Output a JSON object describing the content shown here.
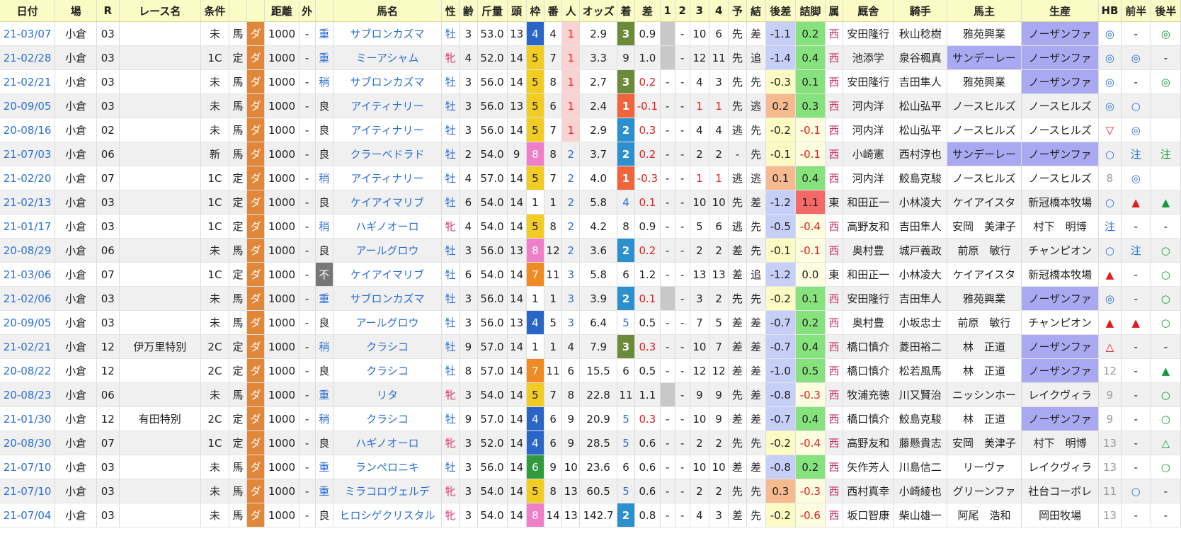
{
  "columns": [
    "日付",
    "場",
    "R",
    "レース名",
    "条件",
    "",
    "",
    "距離",
    "外",
    "",
    "馬名",
    "性",
    "齢",
    "斤量",
    "頭",
    "枠",
    "番",
    "人",
    "オッズ",
    "着",
    "差",
    "1",
    "2",
    "3",
    "4",
    "予",
    "結",
    "後差",
    "詰脚",
    "属",
    "厩舎",
    "騎手",
    "馬主",
    "生産",
    "HB",
    "前半",
    "後半"
  ],
  "colors": {
    "header_bg": "#fbfbc6",
    "link_blue": "#2a6fd6",
    "dirt_orange": "#e0873a",
    "stripe": "#f0f0f0",
    "waku": {
      "1": "#ffffff",
      "4": "#2a65c8",
      "5": "#f1cc22",
      "6": "#2f9b3c",
      "7": "#f08a22",
      "8": "#ef80c8"
    },
    "finish": {
      "1": "#f0643c",
      "2": "#2c8fce",
      "3": "#6b8a3a"
    }
  },
  "rows": [
    {
      "date": "21-03/07",
      "place": "小倉",
      "r": "03",
      "race": "",
      "cls": "未",
      "kind": "馬",
      "surf": "ダ",
      "dist": "1000",
      "out": "-",
      "cond": "重",
      "horse": "サブロンカズマ",
      "sex": "牡",
      "age": "3",
      "kin": "53.0",
      "heads": "13",
      "waku": "4",
      "ban": "4",
      "pop": "1",
      "odds": "2.9",
      "fin": "3",
      "diff": "0.9",
      "p1": "",
      "p2": "-",
      "p3": "10",
      "p4": "6",
      "yo": "先",
      "ke": "差",
      "kosa": "-1.1",
      "tsume": "0.2",
      "zoku": "西",
      "stable": "安田隆行",
      "jockey": "秋山稔樹",
      "owner": "雅苑興業",
      "breeder": "ノーザンファ",
      "hb": "◎",
      "zen": "-",
      "kou": "◎"
    },
    {
      "date": "21-02/28",
      "place": "小倉",
      "r": "03",
      "race": "",
      "cls": "1C",
      "kind": "定",
      "surf": "ダ",
      "dist": "1000",
      "out": "-",
      "cond": "重",
      "horse": "ミーアシャム",
      "sex": "牝",
      "age": "4",
      "kin": "52.0",
      "heads": "14",
      "waku": "5",
      "ban": "7",
      "pop": "1",
      "odds": "3.3",
      "fin": "9",
      "diff": "1.0",
      "p1": "",
      "p2": "-",
      "p3": "12",
      "p4": "11",
      "yo": "先",
      "ke": "追",
      "kosa": "-1.4",
      "tsume": "0.4",
      "zoku": "西",
      "stable": "池添学",
      "jockey": "泉谷楓真",
      "owner": "サンデーレー",
      "breeder": "ノーザンファ",
      "hb": "◎",
      "zen": "◎",
      "kou": "-"
    },
    {
      "date": "21-02/21",
      "place": "小倉",
      "r": "03",
      "race": "",
      "cls": "未",
      "kind": "馬",
      "surf": "ダ",
      "dist": "1000",
      "out": "-",
      "cond": "稍",
      "horse": "サブロンカズマ",
      "sex": "牡",
      "age": "3",
      "kin": "56.0",
      "heads": "14",
      "waku": "5",
      "ban": "8",
      "pop": "1",
      "odds": "2.7",
      "fin": "3",
      "diff": "0.2",
      "p1": "-",
      "p2": "-",
      "p3": "4",
      "p4": "3",
      "yo": "先",
      "ke": "先",
      "kosa": "-0.3",
      "tsume": "0.1",
      "zoku": "西",
      "stable": "安田隆行",
      "jockey": "吉田隼人",
      "owner": "雅苑興業",
      "breeder": "ノーザンファ",
      "hb": "◎",
      "zen": "-",
      "kou": "◎"
    },
    {
      "date": "20-09/05",
      "place": "小倉",
      "r": "03",
      "race": "",
      "cls": "未",
      "kind": "馬",
      "surf": "ダ",
      "dist": "1000",
      "out": "-",
      "cond": "良",
      "horse": "アイティナリー",
      "sex": "牡",
      "age": "3",
      "kin": "56.0",
      "heads": "13",
      "waku": "5",
      "ban": "6",
      "pop": "1",
      "odds": "2.4",
      "fin": "1",
      "diff": "-0.1",
      "p1": "-",
      "p2": "-",
      "p3": "1",
      "p4": "1",
      "yo": "先",
      "ke": "逃",
      "kosa": "0.2",
      "tsume": "0.3",
      "zoku": "西",
      "stable": "河内洋",
      "jockey": "松山弘平",
      "owner": "ノースヒルズ",
      "breeder": "ノースヒルズ",
      "hb": "◎",
      "zen": "○",
      "kou": ""
    },
    {
      "date": "20-08/16",
      "place": "小倉",
      "r": "02",
      "race": "",
      "cls": "未",
      "kind": "馬",
      "surf": "ダ",
      "dist": "1000",
      "out": "-",
      "cond": "良",
      "horse": "アイティナリー",
      "sex": "牡",
      "age": "3",
      "kin": "56.0",
      "heads": "14",
      "waku": "5",
      "ban": "7",
      "pop": "1",
      "odds": "2.9",
      "fin": "2",
      "diff": "0.3",
      "p1": "-",
      "p2": "-",
      "p3": "4",
      "p4": "4",
      "yo": "逃",
      "ke": "先",
      "kosa": "-0.2",
      "tsume": "-0.1",
      "zoku": "西",
      "stable": "河内洋",
      "jockey": "松山弘平",
      "owner": "ノースヒルズ",
      "breeder": "ノースヒルズ",
      "hb": "▽",
      "zen": "◎",
      "kou": ""
    },
    {
      "date": "21-07/03",
      "place": "小倉",
      "r": "06",
      "race": "",
      "cls": "新",
      "kind": "馬",
      "surf": "ダ",
      "dist": "1000",
      "out": "-",
      "cond": "良",
      "horse": "クラーベドラド",
      "sex": "牡",
      "age": "2",
      "kin": "54.0",
      "heads": "9",
      "waku": "8",
      "ban": "8",
      "pop": "2",
      "odds": "3.7",
      "fin": "2",
      "diff": "0.2",
      "p1": "-",
      "p2": "-",
      "p3": "2",
      "p4": "2",
      "yo": "-",
      "ke": "先",
      "kosa": "-0.1",
      "tsume": "-0.1",
      "zoku": "西",
      "stable": "小崎憲",
      "jockey": "西村淳也",
      "owner": "サンデーレー",
      "breeder": "ノーザンファ",
      "hb": "○",
      "zen": "注",
      "kou": "注"
    },
    {
      "date": "21-02/20",
      "place": "小倉",
      "r": "07",
      "race": "",
      "cls": "1C",
      "kind": "定",
      "surf": "ダ",
      "dist": "1000",
      "out": "-",
      "cond": "稍",
      "horse": "アイティナリー",
      "sex": "牡",
      "age": "4",
      "kin": "57.0",
      "heads": "14",
      "waku": "5",
      "ban": "7",
      "pop": "2",
      "odds": "4.0",
      "fin": "1",
      "diff": "-0.3",
      "p1": "-",
      "p2": "-",
      "p3": "1",
      "p4": "1",
      "yo": "逃",
      "ke": "逃",
      "kosa": "0.1",
      "tsume": "0.4",
      "zoku": "西",
      "stable": "河内洋",
      "jockey": "鮫島克駿",
      "owner": "ノースヒルズ",
      "breeder": "ノースヒルズ",
      "hb": "8",
      "zen": "◎",
      "kou": ""
    },
    {
      "date": "21-02/13",
      "place": "小倉",
      "r": "03",
      "race": "",
      "cls": "1C",
      "kind": "定",
      "surf": "ダ",
      "dist": "1000",
      "out": "-",
      "cond": "良",
      "horse": "ケイアイマリブ",
      "sex": "牡",
      "age": "6",
      "kin": "54.0",
      "heads": "14",
      "waku": "1",
      "ban": "1",
      "pop": "2",
      "odds": "5.8",
      "fin": "4",
      "diff": "0.1",
      "p1": "-",
      "p2": "-",
      "p3": "10",
      "p4": "10",
      "yo": "先",
      "ke": "差",
      "kosa": "-1.2",
      "tsume": "1.1",
      "zoku": "東",
      "stable": "和田正一",
      "jockey": "小林凌大",
      "owner": "ケイアイスタ",
      "breeder": "新冠橋本牧場",
      "hb": "○",
      "zen": "▲",
      "kou": "▲"
    },
    {
      "date": "21-01/17",
      "place": "小倉",
      "r": "03",
      "race": "",
      "cls": "1C",
      "kind": "定",
      "surf": "ダ",
      "dist": "1000",
      "out": "-",
      "cond": "稍",
      "horse": "ハギノオーロ",
      "sex": "牝",
      "age": "4",
      "kin": "54.0",
      "heads": "14",
      "waku": "5",
      "ban": "8",
      "pop": "2",
      "odds": "4.2",
      "fin": "8",
      "diff": "0.9",
      "p1": "-",
      "p2": "-",
      "p3": "5",
      "p4": "6",
      "yo": "逃",
      "ke": "先",
      "kosa": "-0.5",
      "tsume": "-0.4",
      "zoku": "西",
      "stable": "高野友和",
      "jockey": "吉田隼人",
      "owner": "安岡　美津子",
      "breeder": "村下　明博",
      "hb": "注",
      "zen": "-",
      "kou": "-"
    },
    {
      "date": "20-08/29",
      "place": "小倉",
      "r": "06",
      "race": "",
      "cls": "未",
      "kind": "馬",
      "surf": "ダ",
      "dist": "1000",
      "out": "-",
      "cond": "良",
      "horse": "アールグロウ",
      "sex": "牡",
      "age": "3",
      "kin": "56.0",
      "heads": "13",
      "waku": "8",
      "ban": "12",
      "pop": "2",
      "odds": "3.6",
      "fin": "2",
      "diff": "0.2",
      "p1": "-",
      "p2": "-",
      "p3": "2",
      "p4": "2",
      "yo": "差",
      "ke": "先",
      "kosa": "-0.1",
      "tsume": "-0.1",
      "zoku": "西",
      "stable": "奥村豊",
      "jockey": "城戸義政",
      "owner": "前原　敏行",
      "breeder": "チャンピオン",
      "hb": "○",
      "zen": "注",
      "kou": "○"
    },
    {
      "date": "21-03/06",
      "place": "小倉",
      "r": "07",
      "race": "",
      "cls": "1C",
      "kind": "定",
      "surf": "ダ",
      "dist": "1000",
      "out": "-",
      "cond": "不",
      "horse": "ケイアイマリブ",
      "sex": "牡",
      "age": "6",
      "kin": "54.0",
      "heads": "14",
      "waku": "7",
      "ban": "11",
      "pop": "3",
      "odds": "5.8",
      "fin": "6",
      "diff": "1.2",
      "p1": "-",
      "p2": "-",
      "p3": "13",
      "p4": "13",
      "yo": "差",
      "ke": "追",
      "kosa": "-1.2",
      "tsume": "0.0",
      "zoku": "東",
      "stable": "和田正一",
      "jockey": "小林凌大",
      "owner": "ケイアイスタ",
      "breeder": "新冠橋本牧場",
      "hb": "▲",
      "zen": "-",
      "kou": "○"
    },
    {
      "date": "21-02/06",
      "place": "小倉",
      "r": "03",
      "race": "",
      "cls": "未",
      "kind": "馬",
      "surf": "ダ",
      "dist": "1000",
      "out": "-",
      "cond": "重",
      "horse": "サブロンカズマ",
      "sex": "牡",
      "age": "3",
      "kin": "56.0",
      "heads": "14",
      "waku": "1",
      "ban": "1",
      "pop": "3",
      "odds": "3.9",
      "fin": "2",
      "diff": "0.1",
      "p1": "",
      "p2": "-",
      "p3": "3",
      "p4": "2",
      "yo": "先",
      "ke": "先",
      "kosa": "-0.2",
      "tsume": "0.1",
      "zoku": "西",
      "stable": "安田隆行",
      "jockey": "吉田隼人",
      "owner": "雅苑興業",
      "breeder": "ノーザンファ",
      "hb": "◎",
      "zen": "-",
      "kou": "○"
    },
    {
      "date": "20-09/05",
      "place": "小倉",
      "r": "03",
      "race": "",
      "cls": "未",
      "kind": "馬",
      "surf": "ダ",
      "dist": "1000",
      "out": "-",
      "cond": "良",
      "horse": "アールグロウ",
      "sex": "牡",
      "age": "3",
      "kin": "56.0",
      "heads": "13",
      "waku": "4",
      "ban": "5",
      "pop": "3",
      "odds": "6.4",
      "fin": "5",
      "diff": "0.5",
      "p1": "-",
      "p2": "-",
      "p3": "7",
      "p4": "5",
      "yo": "差",
      "ke": "差",
      "kosa": "-0.7",
      "tsume": "0.2",
      "zoku": "西",
      "stable": "奥村豊",
      "jockey": "小坂忠士",
      "owner": "前原　敏行",
      "breeder": "チャンピオン",
      "hb": "▲",
      "zen": "▲",
      "kou": "○"
    },
    {
      "date": "21-02/21",
      "place": "小倉",
      "r": "12",
      "race": "伊万里特別",
      "cls": "2C",
      "kind": "定",
      "surf": "ダ",
      "dist": "1000",
      "out": "-",
      "cond": "稍",
      "horse": "クラシコ",
      "sex": "牡",
      "age": "9",
      "kin": "57.0",
      "heads": "14",
      "waku": "1",
      "ban": "1",
      "pop": "4",
      "odds": "7.9",
      "fin": "3",
      "diff": "0.3",
      "p1": "-",
      "p2": "-",
      "p3": "10",
      "p4": "7",
      "yo": "差",
      "ke": "差",
      "kosa": "-0.7",
      "tsume": "0.4",
      "zoku": "西",
      "stable": "橋口慎介",
      "jockey": "菱田裕二",
      "owner": "林　正道",
      "breeder": "ノーザンファ",
      "hb": "△",
      "zen": "-",
      "kou": "-"
    },
    {
      "date": "20-08/22",
      "place": "小倉",
      "r": "12",
      "race": "",
      "cls": "2C",
      "kind": "定",
      "surf": "ダ",
      "dist": "1000",
      "out": "-",
      "cond": "良",
      "horse": "クラシコ",
      "sex": "牡",
      "age": "8",
      "kin": "57.0",
      "heads": "14",
      "waku": "7",
      "ban": "11",
      "pop": "6",
      "odds": "15.5",
      "fin": "6",
      "diff": "0.5",
      "p1": "-",
      "p2": "-",
      "p3": "12",
      "p4": "12",
      "yo": "差",
      "ke": "差",
      "kosa": "-1.0",
      "tsume": "0.5",
      "zoku": "西",
      "stable": "橋口慎介",
      "jockey": "松若風馬",
      "owner": "林　正道",
      "breeder": "ノーザンファ",
      "hb": "12",
      "zen": "-",
      "kou": "▲"
    },
    {
      "date": "20-08/23",
      "place": "小倉",
      "r": "06",
      "race": "",
      "cls": "未",
      "kind": "馬",
      "surf": "ダ",
      "dist": "1000",
      "out": "-",
      "cond": "重",
      "horse": "リタ",
      "sex": "牝",
      "age": "3",
      "kin": "54.0",
      "heads": "14",
      "waku": "5",
      "ban": "7",
      "pop": "8",
      "odds": "22.8",
      "fin": "11",
      "diff": "1.1",
      "p1": "",
      "p2": "-",
      "p3": "9",
      "p4": "9",
      "yo": "先",
      "ke": "差",
      "kosa": "-0.8",
      "tsume": "-0.3",
      "zoku": "西",
      "stable": "牧浦充徳",
      "jockey": "川又賢治",
      "owner": "ニッシンホー",
      "breeder": "レイクヴィラ",
      "hb": "9",
      "zen": "-",
      "kou": "○"
    },
    {
      "date": "21-01/30",
      "place": "小倉",
      "r": "12",
      "race": "有田特別",
      "cls": "2C",
      "kind": "定",
      "surf": "ダ",
      "dist": "1000",
      "out": "-",
      "cond": "稍",
      "horse": "クラシコ",
      "sex": "牡",
      "age": "9",
      "kin": "57.0",
      "heads": "14",
      "waku": "4",
      "ban": "6",
      "pop": "9",
      "odds": "20.9",
      "fin": "5",
      "diff": "0.3",
      "p1": "-",
      "p2": "-",
      "p3": "10",
      "p4": "9",
      "yo": "差",
      "ke": "差",
      "kosa": "-0.7",
      "tsume": "0.4",
      "zoku": "西",
      "stable": "橋口慎介",
      "jockey": "鮫島克駿",
      "owner": "林　正道",
      "breeder": "ノーザンファ",
      "hb": "9",
      "zen": "-",
      "kou": "○"
    },
    {
      "date": "20-08/30",
      "place": "小倉",
      "r": "07",
      "race": "",
      "cls": "1C",
      "kind": "定",
      "surf": "ダ",
      "dist": "1000",
      "out": "-",
      "cond": "良",
      "horse": "ハギノオーロ",
      "sex": "牝",
      "age": "3",
      "kin": "52.0",
      "heads": "14",
      "waku": "4",
      "ban": "6",
      "pop": "9",
      "odds": "28.5",
      "fin": "5",
      "diff": "0.6",
      "p1": "-",
      "p2": "-",
      "p3": "2",
      "p4": "2",
      "yo": "先",
      "ke": "先",
      "kosa": "-0.2",
      "tsume": "-0.4",
      "zoku": "西",
      "stable": "高野友和",
      "jockey": "藤懸貴志",
      "owner": "安岡　美津子",
      "breeder": "村下　明博",
      "hb": "13",
      "zen": "-",
      "kou": "△"
    },
    {
      "date": "21-07/10",
      "place": "小倉",
      "r": "03",
      "race": "",
      "cls": "未",
      "kind": "馬",
      "surf": "ダ",
      "dist": "1000",
      "out": "-",
      "cond": "重",
      "horse": "ランペロニキ",
      "sex": "牡",
      "age": "3",
      "kin": "56.0",
      "heads": "14",
      "waku": "6",
      "ban": "9",
      "pop": "10",
      "odds": "23.6",
      "fin": "6",
      "diff": "0.6",
      "p1": "-",
      "p2": "-",
      "p3": "10",
      "p4": "10",
      "yo": "差",
      "ke": "差",
      "kosa": "-0.8",
      "tsume": "0.2",
      "zoku": "西",
      "stable": "矢作芳人",
      "jockey": "川島信二",
      "owner": "リーヴァ",
      "breeder": "レイクヴィラ",
      "hb": "13",
      "zen": "-",
      "kou": "○"
    },
    {
      "date": "21-07/10",
      "place": "小倉",
      "r": "03",
      "race": "",
      "cls": "未",
      "kind": "馬",
      "surf": "ダ",
      "dist": "1000",
      "out": "-",
      "cond": "重",
      "horse": "ミラコロヴェルデ",
      "sex": "牝",
      "age": "3",
      "kin": "54.0",
      "heads": "14",
      "waku": "5",
      "ban": "8",
      "pop": "13",
      "odds": "60.5",
      "fin": "5",
      "diff": "0.6",
      "p1": "-",
      "p2": "-",
      "p3": "2",
      "p4": "2",
      "yo": "先",
      "ke": "先",
      "kosa": "0.3",
      "tsume": "-0.3",
      "zoku": "西",
      "stable": "西村真幸",
      "jockey": "小崎綾也",
      "owner": "グリーンファ",
      "breeder": "社台コーポレ",
      "hb": "11",
      "zen": "○",
      "kou": "-"
    },
    {
      "date": "21-07/04",
      "place": "小倉",
      "r": "03",
      "race": "",
      "cls": "未",
      "kind": "馬",
      "surf": "ダ",
      "dist": "1000",
      "out": "-",
      "cond": "良",
      "horse": "ヒロシゲクリスタル",
      "sex": "牝",
      "age": "3",
      "kin": "54.0",
      "heads": "14",
      "waku": "8",
      "ban": "14",
      "pop": "13",
      "odds": "142.7",
      "fin": "2",
      "diff": "0.8",
      "p1": "-",
      "p2": "-",
      "p3": "4",
      "p4": "3",
      "yo": "差",
      "ke": "先",
      "kosa": "-0.2",
      "tsume": "-0.6",
      "zoku": "西",
      "stable": "坂口智康",
      "jockey": "柴山雄一",
      "owner": "阿尾　浩和",
      "breeder": "岡田牧場",
      "hb": "13",
      "zen": "-",
      "kou": "-"
    }
  ]
}
